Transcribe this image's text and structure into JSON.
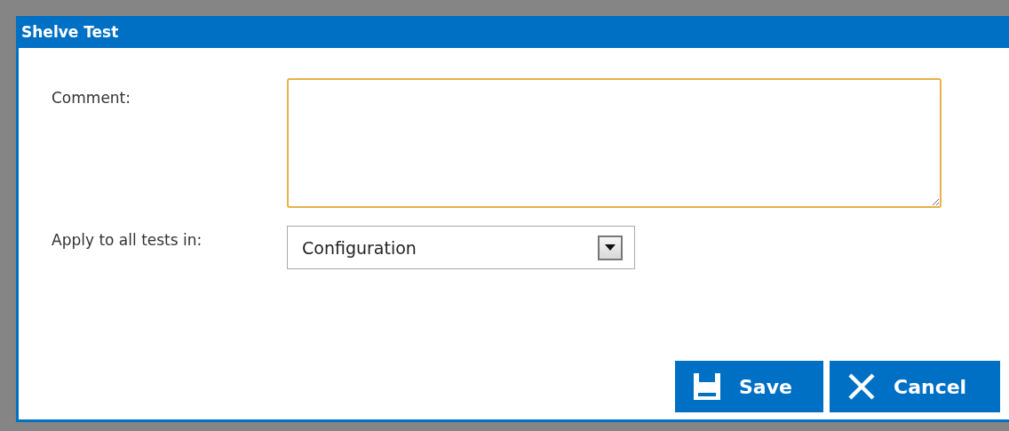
{
  "dialog": {
    "title": "Shelve Test",
    "fields": [
      {
        "kind": "textarea",
        "label": "Comment:",
        "focused": true
      },
      {
        "kind": "select",
        "label": "Apply to all tests in:",
        "value": "Configuration"
      }
    ],
    "buttons": [
      {
        "kind": "save",
        "label": "Save"
      },
      {
        "kind": "cancel",
        "label": "Cancel"
      }
    ]
  }
}
